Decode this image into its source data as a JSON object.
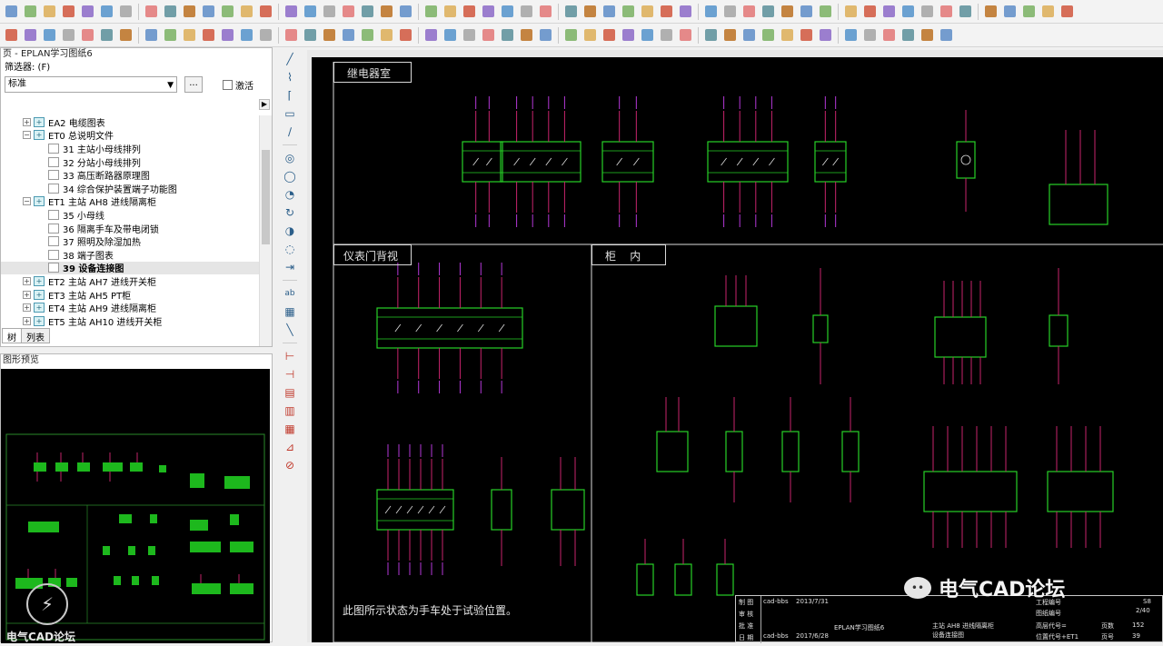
{
  "toolbar1": {
    "icons": [
      "new-icon",
      "open-icon",
      "save-icon",
      "print-icon",
      "cut-icon",
      "copy-icon",
      "paste-icon",
      "undo-icon",
      "redo-icon",
      "refresh-icon",
      "zoom-in-icon",
      "zoom-out-icon",
      "zoom-fit-icon",
      "back-icon",
      "forward-icon",
      "grid-icon",
      "snap-icon",
      "symbol-icon",
      "connection-icon",
      "terminal-icon",
      "cable-icon"
    ]
  },
  "toolbar2": {
    "icons": [
      "page-icon",
      "device-icon",
      "plc-icon",
      "macro-icon",
      "report-icon",
      "check-icon",
      "project-icon",
      "cart-icon"
    ]
  },
  "nav": {
    "title": "页 - EPLAN学习图纸6",
    "filter_label": "筛选器: (F)",
    "filter_value": "标准",
    "dots": "...",
    "activate": "激活",
    "items": [
      {
        "text": "EA2 电缆图表",
        "level": 1,
        "type": "folder",
        "exp": "+"
      },
      {
        "text": "ET0 总说明文件",
        "level": 1,
        "type": "folder",
        "exp": "−"
      },
      {
        "text": "31 主站小母线排列",
        "level": 2,
        "type": "page"
      },
      {
        "text": "32 分站小母线排列",
        "level": 2,
        "type": "page"
      },
      {
        "text": "33 高压断路器原理图",
        "level": 2,
        "type": "page"
      },
      {
        "text": "34 综合保护装置端子功能图",
        "level": 2,
        "type": "page"
      },
      {
        "text": "ET1 主站 AH8 进线隔离柜",
        "level": 1,
        "type": "folder",
        "exp": "−"
      },
      {
        "text": "35 小母线",
        "level": 2,
        "type": "page"
      },
      {
        "text": "36 隔离手车及带电闭锁",
        "level": 2,
        "type": "page"
      },
      {
        "text": "37 照明及除湿加热",
        "level": 2,
        "type": "page"
      },
      {
        "text": "38 端子图表",
        "level": 2,
        "type": "page"
      },
      {
        "text": "39 设备连接图",
        "level": 2,
        "type": "page",
        "selected": true
      },
      {
        "text": "ET2 主站 AH7 进线开关柜",
        "level": 1,
        "type": "folder",
        "exp": "+"
      },
      {
        "text": "ET3 主站 AH5 PT柜",
        "level": 1,
        "type": "folder",
        "exp": "+"
      },
      {
        "text": "ET4 主站 AH9 进线隔离柜",
        "level": 1,
        "type": "folder",
        "exp": "+"
      },
      {
        "text": "ET5 主站 AH10 进线开关柜",
        "level": 1,
        "type": "folder",
        "exp": "+"
      }
    ],
    "tabs": [
      "树",
      "列表"
    ]
  },
  "preview": {
    "title": "图形预览",
    "watermark": "电气CAD论坛"
  },
  "drawing": {
    "section1": "继电器室",
    "section2": "仪表门背视",
    "section3": "柜    内",
    "note": "此图所示状态为手车处于试验位置。",
    "watermark": "电气CAD论坛",
    "title_block": {
      "rows_left": [
        "制 图",
        "审 核",
        "批 准",
        "日 期"
      ],
      "drawer": "cad-bbs",
      "date1": "2013/7/31",
      "date2": "2017/6/28",
      "drawing_name": "EPLAN学习图纸6",
      "project": "主站 AH8 进线隔离柜",
      "sheet_title": "设备连接图",
      "field1": "工程编号",
      "field2": "图纸编号",
      "field3": "高层代号=",
      "field4": "位置代号+ET1",
      "page_label": "页数",
      "page_no": "39",
      "total_label": "页数",
      "total": "152",
      "sheet_label": "页号",
      "sheet": "39",
      "rev": "S8",
      "rev2": "2/40"
    }
  }
}
